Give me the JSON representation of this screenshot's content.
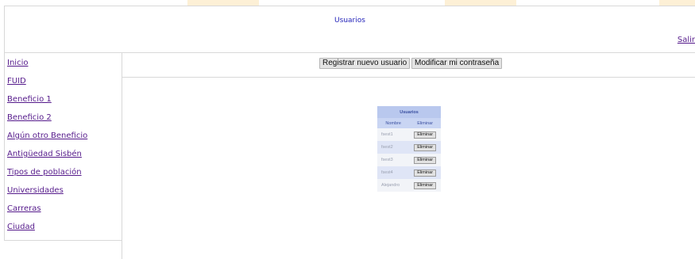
{
  "header": {
    "title": "Usuarios",
    "logout_label": "Salir"
  },
  "sidebar": {
    "items": [
      {
        "label": "Inicio"
      },
      {
        "label": "FUID"
      },
      {
        "label": "Beneficio 1"
      },
      {
        "label": "Beneficio 2"
      },
      {
        "label": "Algún otro Beneficio"
      },
      {
        "label": "Antigüedad Sisbén"
      },
      {
        "label": "Tipos de población"
      },
      {
        "label": "Universidades"
      },
      {
        "label": "Carreras"
      },
      {
        "label": "Ciudad"
      }
    ]
  },
  "toolbar": {
    "register_label": "Registrar nuevo usuario",
    "change_password_label": "Modificar mi contraseña"
  },
  "users_table": {
    "caption": "Usuarios",
    "columns": [
      "Nombre",
      "Eliminar"
    ],
    "rows": [
      {
        "name": "fsest1",
        "action": "Eliminar"
      },
      {
        "name": "fsest2",
        "action": "Eliminar"
      },
      {
        "name": "fsest3",
        "action": "Eliminar"
      },
      {
        "name": "fsest4",
        "action": "Eliminar"
      },
      {
        "name": "Alejandro",
        "action": "Eliminar"
      }
    ]
  },
  "colors": {
    "link": "#551a8b",
    "title": "#1f1fb8",
    "table_header": "#b9c8ee",
    "row_alt": "#dfe5f6"
  }
}
